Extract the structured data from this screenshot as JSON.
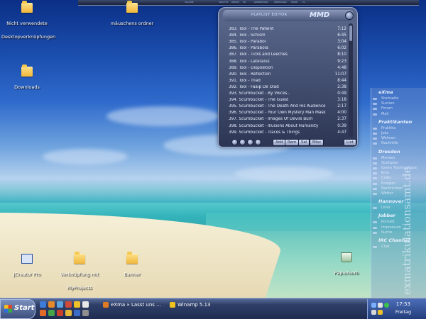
{
  "desktop": {
    "icons": [
      {
        "label": "Nicht verwendete Desktopverknüpfungen"
      },
      {
        "label": "mäuschens ordner"
      },
      {
        "label": "Downloads"
      },
      {
        "label": "JCreator Pro"
      },
      {
        "label": "Verknüpfung mit MyProjects"
      },
      {
        "label": "Banner"
      },
      {
        "label": "Papierkorb"
      }
    ]
  },
  "topbar": {
    "segments": [
      "VOLUME",
      "SHUFFLE",
      "REPEAT",
      "EQ",
      "GENERATION",
      "OBSESSION",
      "MODE",
      "PL"
    ]
  },
  "playlist": {
    "title": "PLAYLIST EDITOR",
    "logo": "MMD",
    "tracks": [
      {
        "name": "383. Tool - The Patient",
        "duration": "7:12"
      },
      {
        "name": "384. Tool - Schism",
        "duration": "6:45"
      },
      {
        "name": "385. Tool - Parabol",
        "duration": "3:04"
      },
      {
        "name": "386. Tool - Parabola",
        "duration": "6:02"
      },
      {
        "name": "387. Tool - Ticks and Leeches",
        "duration": "8:10"
      },
      {
        "name": "388. Tool - Lateralus",
        "duration": "9:23"
      },
      {
        "name": "389. Tool - Disposition",
        "duration": "4:48"
      },
      {
        "name": "390. Tool - Reflection",
        "duration": "11:07"
      },
      {
        "name": "391. Tool - Triad",
        "duration": "8:44"
      },
      {
        "name": "392. Tool - Faaip De Oiad",
        "duration": "2:38"
      },
      {
        "name": "393. Scumbucket - By Voices..",
        "duration": "0:49"
      },
      {
        "name": "394. Scumbucket - The Guest",
        "duration": "3:18"
      },
      {
        "name": "395. Scumbucket - The Death And His Audience",
        "duration": "2:17"
      },
      {
        "name": "396. Scumbucket - Your Own Mystery Man Mask",
        "duration": "4:00"
      },
      {
        "name": "397. Scumbucket - Images Of Devils Burn",
        "duration": "2:37"
      },
      {
        "name": "398. Scumbucket - Illusions About Humanity",
        "duration": "0:39"
      },
      {
        "name": "399. Scumbucket - Traces & Things",
        "duration": "4:47"
      }
    ],
    "buttons": {
      "add": "Add",
      "rem": "Rem",
      "sel": "Sel",
      "misc": "Misc",
      "list": "List"
    }
  },
  "exma": {
    "sections": [
      {
        "heading": "eXma",
        "items": [
          "Startseite",
          "Suchen",
          "Forum",
          "Mail"
        ]
      },
      {
        "heading": "Praktikanten",
        "items": [
          "Praktika",
          "Jobs",
          "Wohnen",
          "Nachhilfe"
        ]
      },
      {
        "heading": "Dresden",
        "items": [
          "Mensen",
          "Stadtplan",
          "Green Trading Plaza",
          "Kino",
          "Clubs",
          "Kneipen",
          "Nachrichten",
          "Wetter"
        ]
      },
      {
        "heading": "Hannover",
        "items": [
          "Links"
        ]
      },
      {
        "heading": "Jobber",
        "items": [
          "Kontakt",
          "Impressum",
          "Suche"
        ]
      },
      {
        "heading": "IRC Channel",
        "items": [
          "Chat"
        ]
      }
    ],
    "watermark": "exmatrikulationsamt.de"
  },
  "taskbar": {
    "start_label": "Start",
    "tasks": [
      {
        "label": "eXma » Lasst uns ..."
      },
      {
        "label": "Winamp 5.13"
      }
    ],
    "clock": "17:53",
    "day": "Freitag"
  }
}
